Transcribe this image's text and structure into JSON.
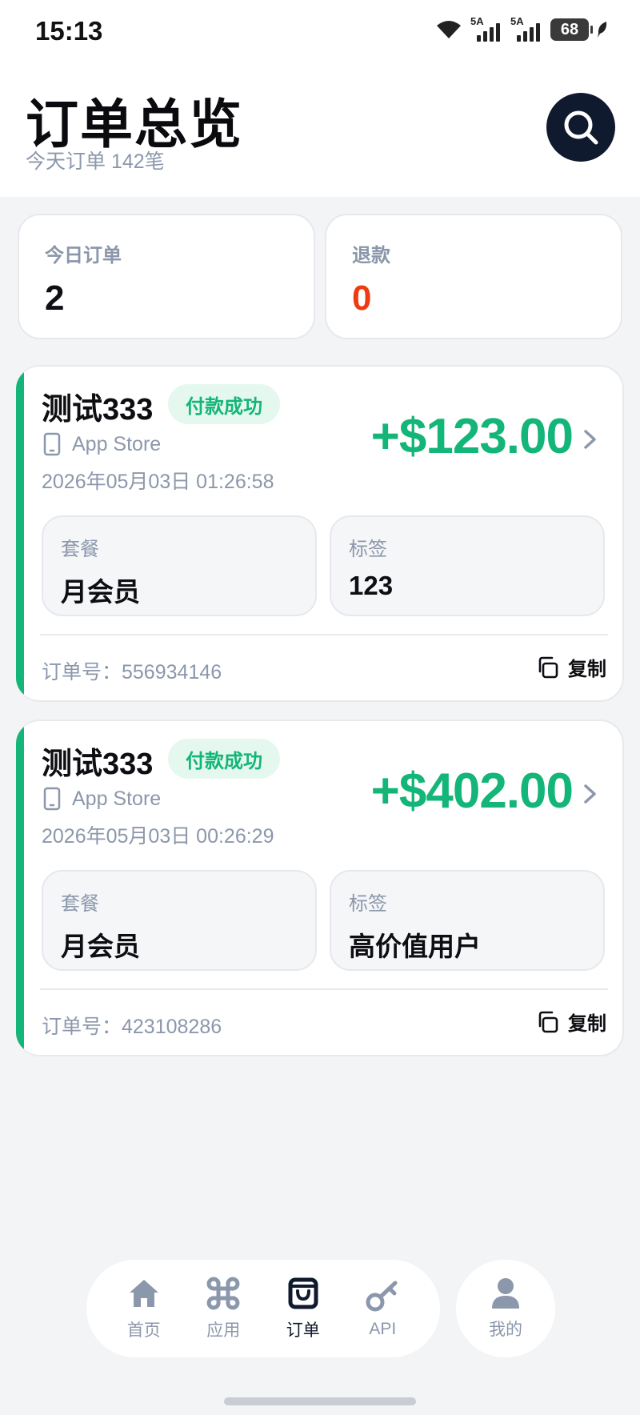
{
  "status_bar": {
    "time": "15:13",
    "sim1": "5A",
    "sim2": "5A",
    "battery": "68"
  },
  "header": {
    "title": "订单总览",
    "subtitle": "今天订单 142笔",
    "search_icon": "search-icon"
  },
  "stats": [
    {
      "label": "今日订单",
      "value": "2",
      "color": "#0f0f14"
    },
    {
      "label": "退款",
      "value": "0",
      "color": "#ee3b13"
    }
  ],
  "orders": [
    {
      "name": "测试333",
      "status": "付款成功",
      "source": "App Store",
      "time": "2026年05月03日 01:26:58",
      "amount": "+$123.00",
      "plan_label": "套餐",
      "plan_value": "月会员",
      "tag_label": "标签",
      "tag_value": "123",
      "order_no": "订单号：556934146",
      "copy_label": "复制"
    },
    {
      "name": "测试333",
      "status": "付款成功",
      "source": "App Store",
      "time": "2026年05月03日 00:26:29",
      "amount": "+$402.00",
      "plan_label": "套餐",
      "plan_value": "月会员",
      "tag_label": "标签",
      "tag_value": "高价值用户",
      "order_no": "订单号：423108286",
      "copy_label": "复制"
    }
  ],
  "nav": {
    "items": [
      {
        "label": "首页",
        "icon": "home-icon"
      },
      {
        "label": "应用",
        "icon": "command-icon"
      },
      {
        "label": "订单",
        "icon": "shopping-bag-icon",
        "active": true
      },
      {
        "label": "API",
        "icon": "key-icon"
      }
    ],
    "profile": {
      "label": "我的",
      "icon": "user-icon"
    }
  },
  "colors": {
    "accent_green": "#13b578",
    "refund_red": "#ee3b13",
    "dark_navy": "#101a2e",
    "muted_text": "#8b97ab"
  }
}
